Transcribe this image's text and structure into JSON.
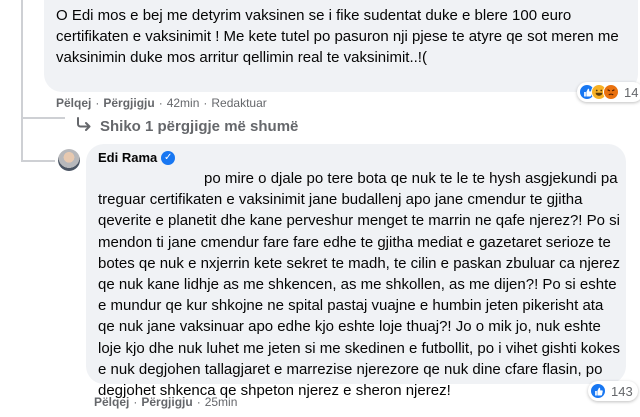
{
  "comment1": {
    "text": "O Edi mos e bej me detyrim vaksinen se i fike sudentat duke e blere 100 euro certifikaten e vaksinimit ! Me kete tutel po pasuron nji pjese te atyre qe sot meren me vaksinimin duke mos arritur qellimin real te vaksinimit..!(",
    "actions": {
      "like": "Pëlqej",
      "reply": "Përgjigju",
      "time": "42min",
      "edited": "Redaktuar"
    },
    "reactions": {
      "icons": [
        "like-icon",
        "laugh-icon",
        "angry-icon"
      ],
      "count": "14"
    }
  },
  "more_replies": {
    "label": "Shiko 1 përgjigje më shumë"
  },
  "reply": {
    "author": "Edi Rama",
    "verified": true,
    "text": "po mire o djale po tere bota qe nuk te le te hysh asgjekundi pa treguar certifikaten e vaksinimit jane budallenj apo jane cmendur te gjitha qeverite e planetit dhe kane perveshur menget te marrin ne qafe njerez?! Po si mendon ti jane cmendur fare fare edhe te gjitha mediat e gazetaret serioze te botes qe nuk e nxjerrin kete sekret te madh, te cilin e paskan zbuluar ca njerez qe nuk kane lidhje as me shkencen, as me shkollen, as me dijen?! Po si eshte e mundur qe kur shkojne ne spital pastaj vuajne e humbin jeten pikerisht ata qe nuk jane vaksinuar apo edhe kjo eshte loje thuaj?! Jo o mik jo, nuk eshte loje kjo dhe nuk luhet me jeten si me skedinen e futbollit, po i vihet gishti kokes e nuk degjohen tallagjaret e marrezise njerezore qe nuk dine cfare flasin, po degjohet shkenca qe shpeton njerez e sheron njerez!",
    "actions": {
      "like": "Pëlqej",
      "reply": "Përgjigju",
      "time": "25min"
    },
    "reactions": {
      "icons": [
        "like-icon"
      ],
      "count": "143"
    }
  },
  "colors": {
    "bubble": "#f0f2f5",
    "meta": "#65676b",
    "like": "#1877f2",
    "text": "#050505"
  }
}
